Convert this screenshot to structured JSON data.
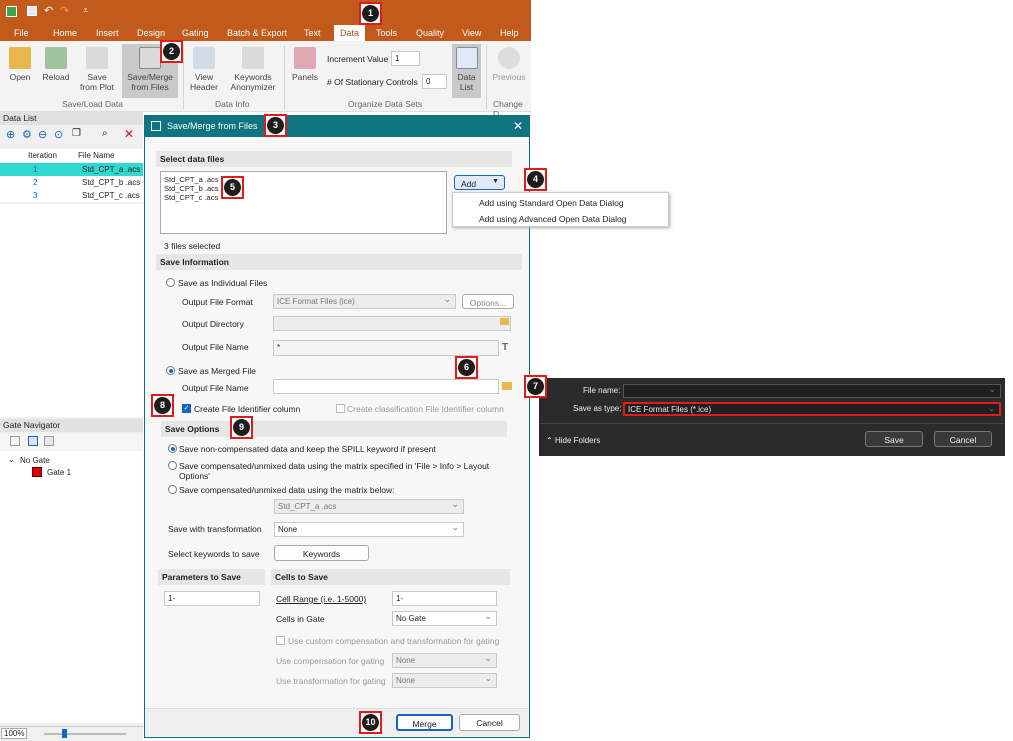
{
  "badges": [
    "1",
    "2",
    "3",
    "4",
    "5",
    "6",
    "7",
    "8",
    "9",
    "10"
  ],
  "ribbon": {
    "tabs": [
      "File",
      "Home",
      "Insert",
      "Design",
      "Gating",
      "Batch & Export",
      "Text",
      "Data",
      "Tools",
      "Quality",
      "View",
      "Help"
    ],
    "buttons": {
      "open": "Open",
      "reload": "Reload",
      "save_from_plot": "Save from Plot",
      "save_merge": "Save/Merge from Files",
      "view_header": "View Header",
      "keywords_anonymizer": "Keywords Anonymizer",
      "panels": "Panels",
      "data_list": "Data List",
      "previous": "Previous"
    },
    "increment_label": "Increment Value",
    "increment_value": "1",
    "stationary_label": "# Of Stationary Controls",
    "stationary_value": "0",
    "groups": [
      "Save/Load Data",
      "Data Info",
      "Organize Data Sets",
      "Change D"
    ]
  },
  "data_list": {
    "title": "Data List",
    "columns": [
      "Iteration",
      "File Name"
    ],
    "rows": [
      {
        "iteration": "1",
        "file": "Std_CPT_a .acs"
      },
      {
        "iteration": "2",
        "file": "Std_CPT_b .acs"
      },
      {
        "iteration": "3",
        "file": "Std_CPT_c .acs"
      }
    ]
  },
  "gate_navigator": {
    "title": "Gate Navigator",
    "root": "No Gate",
    "child": "Gate 1"
  },
  "statusbar": {
    "zoom": "100%"
  },
  "dialog": {
    "title": "Save/Merge from Files",
    "select_section": "Select data files",
    "files": [
      "Std_CPT_a .acs",
      "Std_CPT_b .acs",
      "Std_CPT_c .acs"
    ],
    "add_button": "Add",
    "add_menu": [
      "Add using Standard Open Data Dialog",
      "Add using Advanced Open Data Dialog"
    ],
    "files_selected": "3 files selected",
    "save_info_section": "Save Information",
    "save_individual": "Save as Individual Files",
    "output_format_label": "Output File Format",
    "output_format_value": "ICE Format Files (ice)",
    "options_button": "Options...",
    "output_dir_label": "Output Directory",
    "output_name_label": "Output File Name",
    "output_name_value": "*",
    "save_merged": "Save as Merged File",
    "merged_name_label": "Output File Name",
    "create_id": "Create File Identifier column",
    "create_class_id": "Create classification File Identifier column",
    "save_options_section": "Save Options",
    "opt1": "Save non-compensated data and keep the SPILL keyword if present",
    "opt2": "Save compensated/unmixed data using the matrix specified in 'File > Info > Layout Options'",
    "opt3": "Save compensated/unmixed data using the matrix below:",
    "matrix_value": "Std_CPT_a .acs",
    "transformation_label": "Save with transformation",
    "transformation_value": "None",
    "keywords_label": "Select keywords to save",
    "keywords_button": "Keywords",
    "params_section": "Parameters to Save",
    "params_value": "1-",
    "cells_section": "Cells to Save",
    "cell_range_label": "Cell Range (i.e. 1-5000)",
    "cell_range_value": "1-",
    "cells_in_gate_label": "Cells in Gate",
    "cells_in_gate_value": "No Gate",
    "custom_comp": "Use custom compensation and transformation for gating",
    "comp_gating_label": "Use compensation for gating",
    "comp_gating_value": "None",
    "trans_gating_label": "Use transformation for gating",
    "trans_gating_value": "None",
    "merge_button": "Merge",
    "cancel_button": "Cancel"
  },
  "save_dialog": {
    "file_name_label": "File name:",
    "type_label": "Save as type:",
    "type_value": "ICE Format Files (*.ice)",
    "hide_folders": "Hide Folders",
    "save_button": "Save",
    "cancel_button": "Cancel"
  }
}
